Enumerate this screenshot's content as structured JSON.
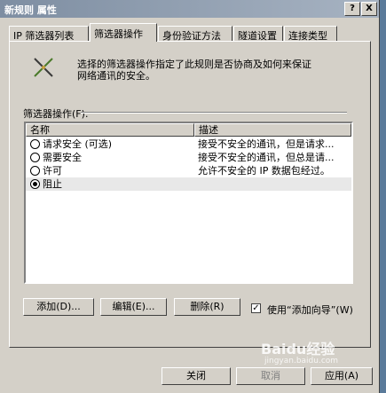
{
  "window": {
    "title": "新规则 属性",
    "help_label": "?",
    "close_label": "X"
  },
  "tabs": [
    {
      "label": "IP 筛选器列表"
    },
    {
      "label": "筛选器操作"
    },
    {
      "label": "身份验证方法"
    },
    {
      "label": "隧道设置"
    },
    {
      "label": "连接类型"
    }
  ],
  "active_tab": "筛选器操作",
  "panel": {
    "icon": "filter-action-icon",
    "description_line1": "选择的筛选器操作指定了此规则是否协商及如何来保证",
    "description_line2": "网络通讯的安全。",
    "group_label": "筛选器操作(F):",
    "columns": [
      "名称",
      "描述"
    ],
    "rows": [
      {
        "name": "请求安全 (可选)",
        "desc": "接受不安全的通讯，但是请求...",
        "checked": false
      },
      {
        "name": "需要安全",
        "desc": "接受不安全的通讯，但总是请...",
        "checked": false
      },
      {
        "name": "许可",
        "desc": "允许不安全的 IP 数据包经过。",
        "checked": false
      },
      {
        "name": "阻止",
        "desc": "",
        "checked": true
      }
    ],
    "add_button": "添加(D)...",
    "edit_button": "编辑(E)...",
    "remove_button": "删除(R)",
    "wizard_checkbox_label": "使用“添加向导”(W)",
    "wizard_checked": true
  },
  "footer": {
    "close_button": "关闭",
    "cancel_button": "取消",
    "apply_button": "应用(A)"
  },
  "watermark": {
    "brand": "Baidu经验",
    "url": "jingyan.baidu.com"
  }
}
